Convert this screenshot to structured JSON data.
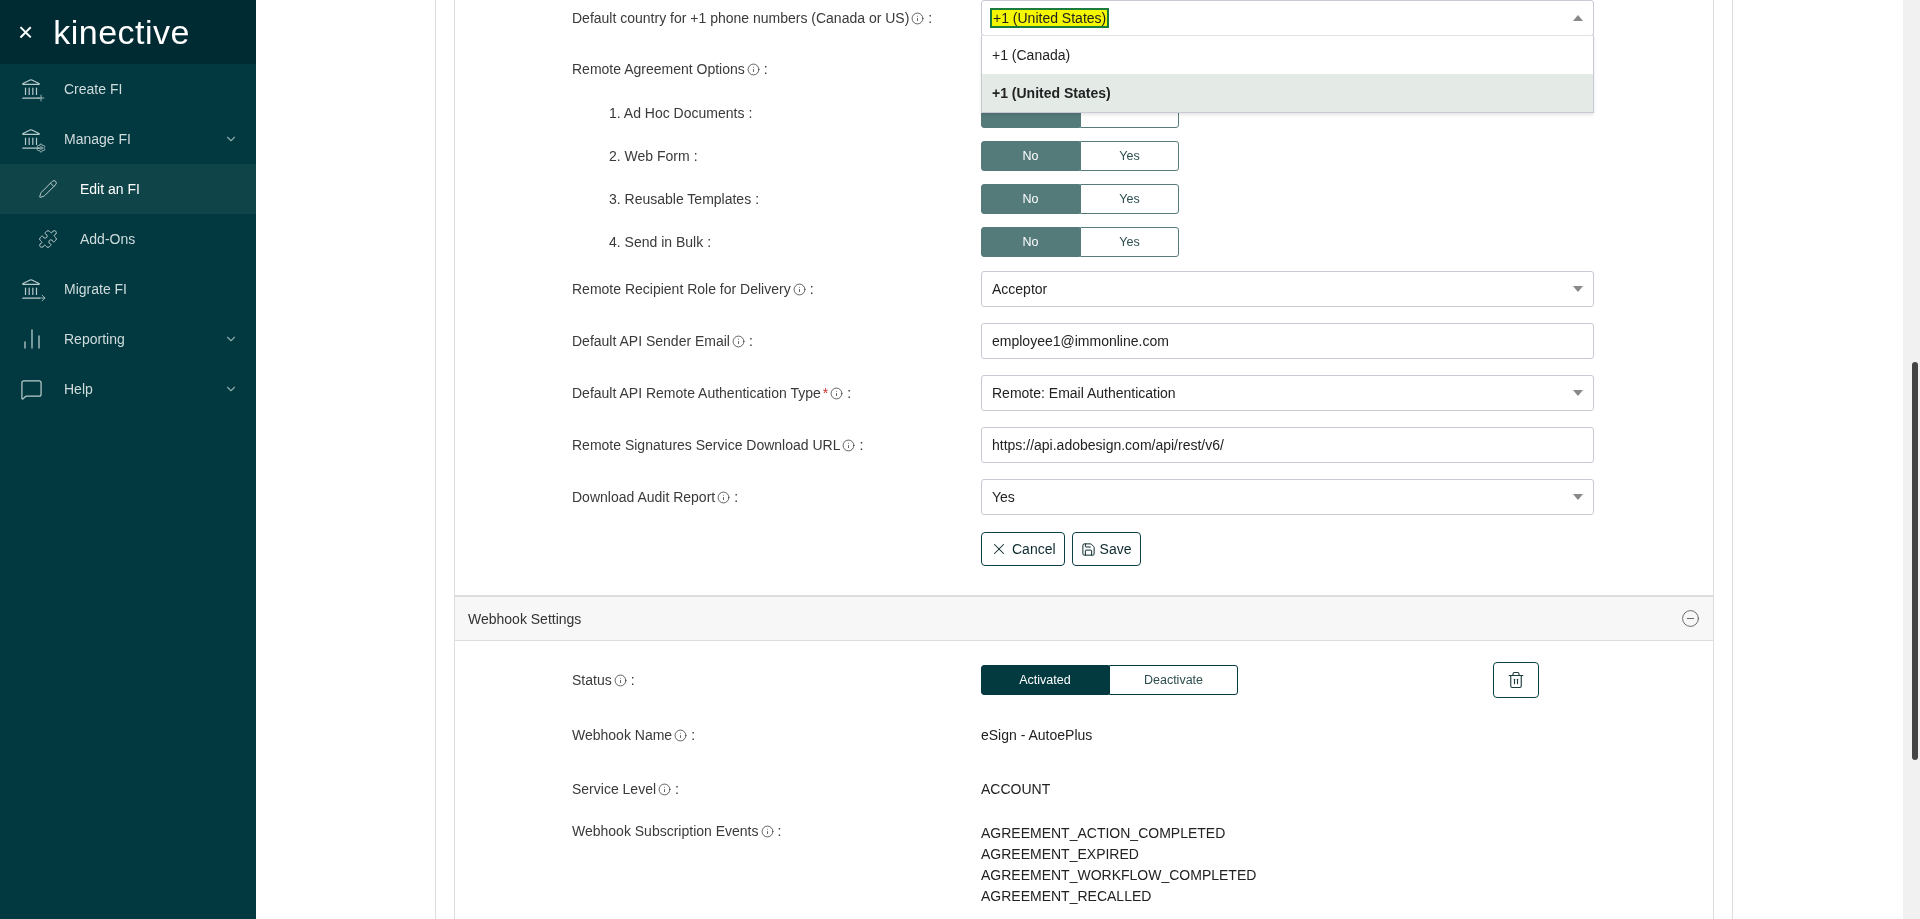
{
  "sidebar": {
    "close": "×",
    "logo": "kinective",
    "items": [
      {
        "label": "Create FI",
        "expandable": false,
        "selected": false
      },
      {
        "label": "Manage FI",
        "expandable": true,
        "selected": false,
        "children": [
          {
            "label": "Edit an FI",
            "selected": true
          },
          {
            "label": "Add-Ons",
            "selected": false
          }
        ]
      },
      {
        "label": "Migrate FI",
        "expandable": false,
        "selected": false
      },
      {
        "label": "Reporting",
        "expandable": true,
        "selected": false
      },
      {
        "label": "Help",
        "expandable": true,
        "selected": false
      }
    ]
  },
  "form": {
    "rows": [
      {
        "kind": "dropdown",
        "label": "Default country for +1 phone numbers (Canada or US)",
        "info": true,
        "value": "+1 (United States)",
        "open": true,
        "options": [
          {
            "label": "+1 (Canada)",
            "selected": false
          },
          {
            "label": "+1 (United States)",
            "selected": true
          }
        ]
      },
      {
        "kind": "heading",
        "label": "Remote Agreement Options",
        "info": true
      },
      {
        "kind": "toggle",
        "label": "1. Ad Hoc Documents",
        "options": [
          {
            "selected": true
          },
          {
            "selected": false
          }
        ]
      },
      {
        "kind": "toggle",
        "label": "2. Web Form",
        "options": [
          {
            "label": "No",
            "selected": true
          },
          {
            "label": "Yes",
            "selected": false
          }
        ]
      },
      {
        "kind": "toggle",
        "label": "3. Reusable Templates",
        "options": [
          {
            "label": "No",
            "selected": true
          },
          {
            "label": "Yes",
            "selected": false
          }
        ]
      },
      {
        "kind": "toggle",
        "label": "4. Send in Bulk",
        "options": [
          {
            "label": "No",
            "selected": true
          },
          {
            "label": "Yes",
            "selected": false
          }
        ]
      },
      {
        "kind": "select",
        "label": "Remote Recipient Role for Delivery",
        "info": true,
        "value": "Acceptor"
      },
      {
        "kind": "input",
        "label": "Default API Sender Email",
        "info": true,
        "value": "employee1@immonline.com"
      },
      {
        "kind": "select",
        "label": "Default API Remote Authentication Type",
        "info": true,
        "required": true,
        "value": "Remote: Email Authentication"
      },
      {
        "kind": "input",
        "label": "Remote Signatures Service Download URL",
        "info": true,
        "value": "https://api.adobesign.com/api/rest/v6/"
      },
      {
        "kind": "select",
        "label": "Download Audit Report",
        "info": true,
        "value": "Yes"
      }
    ],
    "colon": ":",
    "required_mark": "*",
    "cancel": "Cancel",
    "save": "Save"
  },
  "webhook": {
    "title": "Webhook Settings",
    "expanded": true,
    "colon": ":",
    "status": {
      "label": "Status",
      "options": [
        {
          "label": "Activated",
          "selected": true
        },
        {
          "label": "Deactivate",
          "selected": false
        }
      ]
    },
    "fields": [
      {
        "label": "Webhook Name",
        "values": [
          "eSign - AutoePlus"
        ]
      },
      {
        "label": "Service Level",
        "values": [
          "ACCOUNT"
        ]
      },
      {
        "label": "Webhook Subscription Events",
        "values": [
          "AGREEMENT_ACTION_COMPLETED",
          "AGREEMENT_EXPIRED",
          "AGREEMENT_WORKFLOW_COMPLETED",
          "AGREEMENT_RECALLED"
        ]
      }
    ]
  }
}
